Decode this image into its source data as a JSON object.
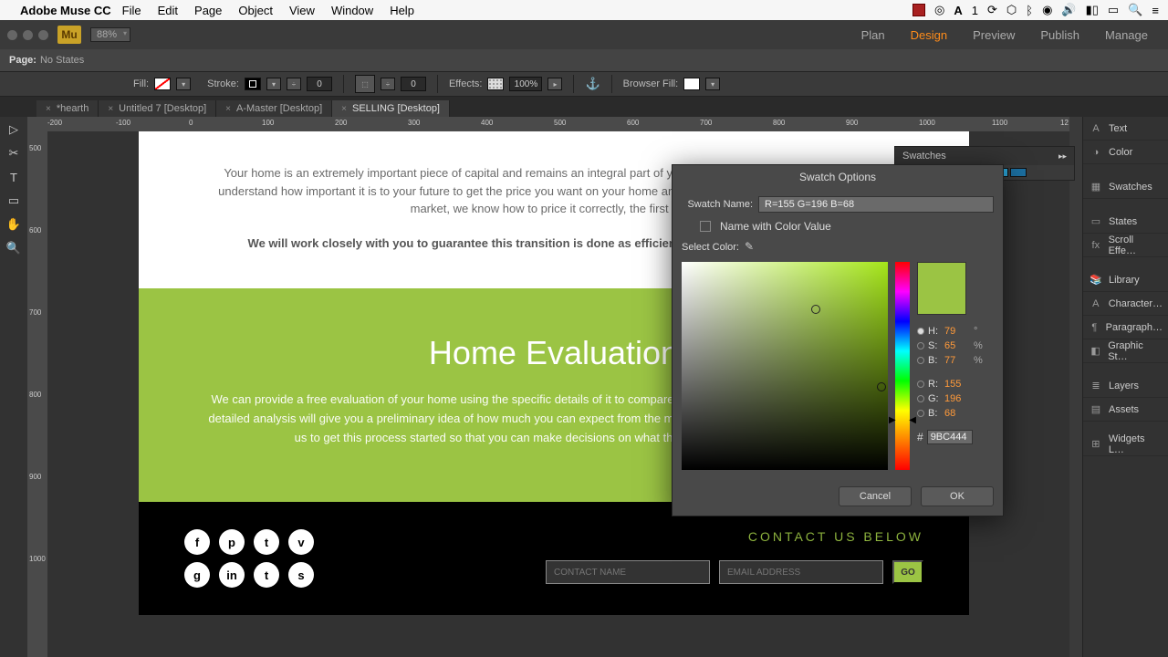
{
  "mac": {
    "app": "Adobe Muse CC",
    "menus": [
      "File",
      "Edit",
      "Page",
      "Object",
      "View",
      "Window",
      "Help"
    ],
    "right": "1"
  },
  "modes": {
    "plan": "Plan",
    "design": "Design",
    "preview": "Preview",
    "publish": "Publish",
    "manage": "Manage"
  },
  "zoom": "88%",
  "page_label": "Page:",
  "page_state": "No States",
  "props": {
    "fill": "Fill:",
    "stroke": "Stroke:",
    "stroke_v": "0",
    "corner_v": "0",
    "effects": "Effects:",
    "effects_v": "100%",
    "browser": "Browser Fill:"
  },
  "tabs": [
    {
      "label": "*hearth",
      "active": false
    },
    {
      "label": "Untitled 7 [Desktop]",
      "active": false
    },
    {
      "label": "A-Master [Desktop]",
      "active": false
    },
    {
      "label": "SELLING [Desktop]",
      "active": true
    }
  ],
  "hruler": [
    "-200",
    "-100",
    "0",
    "100",
    "200",
    "300",
    "400",
    "500",
    "600",
    "700",
    "800",
    "900",
    "1000",
    "1100",
    "12"
  ],
  "vruler": [
    "500",
    "600",
    "700",
    "800",
    "900",
    "1000"
  ],
  "content": {
    "p1": "Your home is an extremely important piece of capital and remains an integral part of your life, even while you are selling it. We understand how important it is to your future to get the price you want on your home and with our considerable knowledge of the market, we know how to price it correctly, the first time.",
    "p1b": "We will work closely with you to guarantee this transition is done as efficiently and successfully as possible.",
    "h2": "Home Evaluation",
    "p2": "We can provide a free evaluation of your home using the specific details of it to compare it with relevant current market prices. This detailed analysis will give you a preliminary idea of how much you can expect from the market and for what you should aim. Contact us to get this process started so that you can make decisions on what the future holds next for you.",
    "contact_title": "CONTACT US BELOW",
    "name_ph": "CONTACT NAME",
    "email_ph": "EMAIL ADDRESS",
    "go": "GO"
  },
  "social": [
    "f",
    "p",
    "t",
    "v",
    "g",
    "in",
    "t",
    "s"
  ],
  "rail": [
    "Text",
    "Color",
    "Swatches",
    "States",
    "Scroll Effe…",
    "Library",
    "Character…",
    "Paragraph…",
    "Graphic St…",
    "Layers",
    "Assets",
    "Widgets L…"
  ],
  "swatches_panel": "Swatches",
  "dialog": {
    "title": "Swatch Options",
    "name_label": "Swatch Name:",
    "name_value": "R=155 G=196 B=68",
    "chk_label": "Name with Color Value",
    "select_label": "Select Color:",
    "values": {
      "H": {
        "lbl": "H:",
        "v": "79",
        "u": "°"
      },
      "S": {
        "lbl": "S:",
        "v": "65",
        "u": "%"
      },
      "B": {
        "lbl": "B:",
        "v": "77",
        "u": "%"
      },
      "R": {
        "lbl": "R:",
        "v": "155",
        "u": ""
      },
      "G": {
        "lbl": "G:",
        "v": "196",
        "u": ""
      },
      "Bb": {
        "lbl": "B:",
        "v": "68",
        "u": ""
      }
    },
    "hex": "9BC444",
    "cancel": "Cancel",
    "ok": "OK",
    "preview": "#9bc444",
    "sv_x": "65%",
    "sv_y": "23%"
  }
}
